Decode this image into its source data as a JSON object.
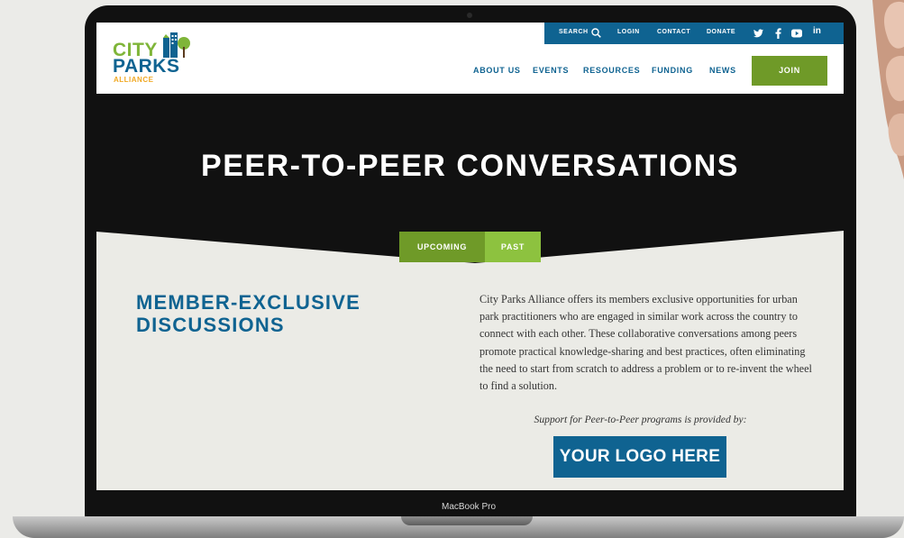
{
  "device": {
    "model_label": "MacBook Pro"
  },
  "site": {
    "logo": {
      "line1": "CITY",
      "line2": "PARKS",
      "line3": "ALLIANCE"
    },
    "topbar": {
      "search_label": "SEARCH",
      "items": [
        "LOGIN",
        "CONTACT",
        "DONATE"
      ],
      "social_icons": [
        "twitter-icon",
        "facebook-icon",
        "youtube-icon",
        "linkedin-icon"
      ]
    },
    "nav": {
      "items": [
        "ABOUT US",
        "EVENTS",
        "RESOURCES",
        "FUNDING",
        "NEWS"
      ],
      "join_label": "JOIN"
    },
    "hero": {
      "title": "PEER-TO-PEER CONVERSATIONS"
    },
    "tabs": [
      {
        "label": "UPCOMING",
        "active": true
      },
      {
        "label": "PAST",
        "active": false
      }
    ],
    "section": {
      "heading_line1": "MEMBER-EXCLUSIVE",
      "heading_line2": "DISCUSSIONS",
      "body": "City Parks Alliance offers its members exclusive opportunities for urban park practitioners who are engaged in similar work across the country to connect with each other.  These collaborative conversations among peers promote practical knowledge-sharing and best practices, often eliminating the need to start from scratch to address a problem or to re-invent the wheel to find a solution.",
      "support_text": "Support for Peer-to-Peer programs is provided by:",
      "sponsor_logo_text": "YOUR LOGO HERE"
    }
  },
  "colors": {
    "brand_blue": "#0f6391",
    "brand_green": "#6f9a28",
    "light_green": "#8dc23f",
    "accent_orange": "#f0a824",
    "hero_bg": "#111111"
  }
}
